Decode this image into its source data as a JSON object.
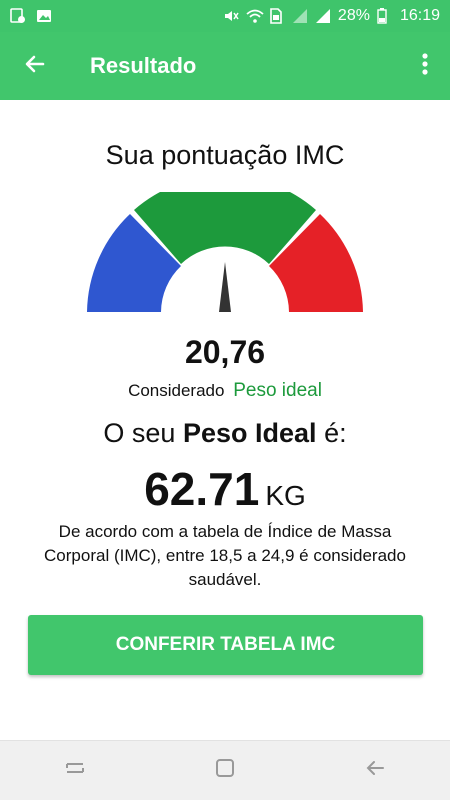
{
  "status_bar": {
    "battery": "28%",
    "time": "16:19"
  },
  "app_bar": {
    "title": "Resultado"
  },
  "result": {
    "heading": "Sua pontuação IMC",
    "bmi": "20,76",
    "considered_prefix": "Considerado",
    "status": "Peso ideal",
    "ideal_prefix": "O seu",
    "ideal_bold": "Peso Ideal",
    "ideal_suffix": "é:",
    "ideal_weight": "62.71",
    "unit": "KG",
    "description": "De acordo com a tabela de Índice de Massa Corporal (IMC), entre 18,5 a 24,9 é considerado saudável."
  },
  "button": {
    "label": "CONFERIR TABELA IMC"
  },
  "colors": {
    "accent": "#41c66c",
    "underweight": "#2f57d0",
    "normal": "#1d9a3c",
    "overweight": "#e52127",
    "status_text": "#1d9a3c"
  },
  "gauge": {
    "segments": [
      "blue",
      "green",
      "red"
    ],
    "needle_level": 0.5
  }
}
